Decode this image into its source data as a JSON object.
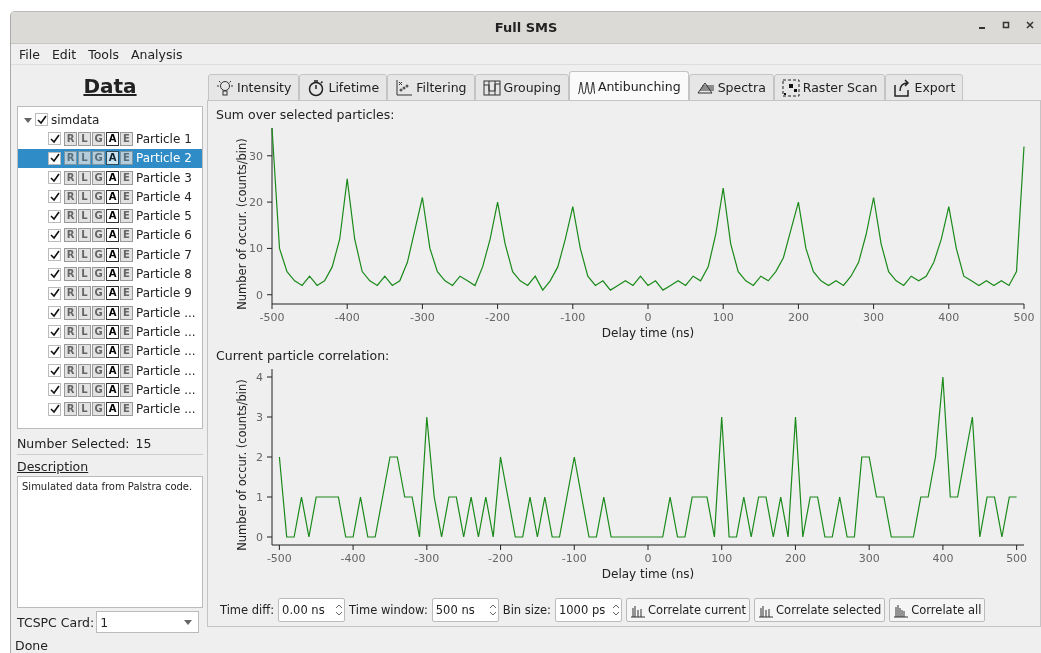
{
  "window": {
    "title": "Full SMS"
  },
  "menu": [
    "File",
    "Edit",
    "Tools",
    "Analysis"
  ],
  "data_panel": {
    "title": "Data",
    "tree": {
      "label": "simdata",
      "checked": true,
      "expanded": true,
      "children": [
        {
          "label": "Particle 1",
          "checked": true,
          "selected": false,
          "flags": [
            {
              "label": "R",
              "on": false
            },
            {
              "label": "L",
              "on": false
            },
            {
              "label": "G",
              "on": false
            },
            {
              "label": "A",
              "on": true
            },
            {
              "label": "E",
              "on": false
            }
          ]
        },
        {
          "label": "Particle 2",
          "checked": true,
          "selected": true,
          "flags": [
            {
              "label": "R",
              "on": false
            },
            {
              "label": "L",
              "on": false
            },
            {
              "label": "G",
              "on": false
            },
            {
              "label": "A",
              "on": true
            },
            {
              "label": "E",
              "on": false
            }
          ]
        },
        {
          "label": "Particle 3",
          "checked": true,
          "selected": false,
          "flags": [
            {
              "label": "R",
              "on": false
            },
            {
              "label": "L",
              "on": false
            },
            {
              "label": "G",
              "on": false
            },
            {
              "label": "A",
              "on": true
            },
            {
              "label": "E",
              "on": false
            }
          ]
        },
        {
          "label": "Particle 4",
          "checked": true,
          "selected": false,
          "flags": [
            {
              "label": "R",
              "on": false
            },
            {
              "label": "L",
              "on": false
            },
            {
              "label": "G",
              "on": false
            },
            {
              "label": "A",
              "on": true
            },
            {
              "label": "E",
              "on": false
            }
          ]
        },
        {
          "label": "Particle 5",
          "checked": true,
          "selected": false,
          "flags": [
            {
              "label": "R",
              "on": false
            },
            {
              "label": "L",
              "on": false
            },
            {
              "label": "G",
              "on": false
            },
            {
              "label": "A",
              "on": true
            },
            {
              "label": "E",
              "on": false
            }
          ]
        },
        {
          "label": "Particle 6",
          "checked": true,
          "selected": false,
          "flags": [
            {
              "label": "R",
              "on": false
            },
            {
              "label": "L",
              "on": false
            },
            {
              "label": "G",
              "on": false
            },
            {
              "label": "A",
              "on": true
            },
            {
              "label": "E",
              "on": false
            }
          ]
        },
        {
          "label": "Particle 7",
          "checked": true,
          "selected": false,
          "flags": [
            {
              "label": "R",
              "on": false
            },
            {
              "label": "L",
              "on": false
            },
            {
              "label": "G",
              "on": false
            },
            {
              "label": "A",
              "on": true
            },
            {
              "label": "E",
              "on": false
            }
          ]
        },
        {
          "label": "Particle 8",
          "checked": true,
          "selected": false,
          "flags": [
            {
              "label": "R",
              "on": false
            },
            {
              "label": "L",
              "on": false
            },
            {
              "label": "G",
              "on": false
            },
            {
              "label": "A",
              "on": true
            },
            {
              "label": "E",
              "on": false
            }
          ]
        },
        {
          "label": "Particle 9",
          "checked": true,
          "selected": false,
          "flags": [
            {
              "label": "R",
              "on": false
            },
            {
              "label": "L",
              "on": false
            },
            {
              "label": "G",
              "on": false
            },
            {
              "label": "A",
              "on": true
            },
            {
              "label": "E",
              "on": false
            }
          ]
        },
        {
          "label": "Particle ...",
          "checked": true,
          "selected": false,
          "flags": [
            {
              "label": "R",
              "on": false
            },
            {
              "label": "L",
              "on": false
            },
            {
              "label": "G",
              "on": false
            },
            {
              "label": "A",
              "on": true
            },
            {
              "label": "E",
              "on": false
            }
          ]
        },
        {
          "label": "Particle ...",
          "checked": true,
          "selected": false,
          "flags": [
            {
              "label": "R",
              "on": false
            },
            {
              "label": "L",
              "on": false
            },
            {
              "label": "G",
              "on": false
            },
            {
              "label": "A",
              "on": true
            },
            {
              "label": "E",
              "on": false
            }
          ]
        },
        {
          "label": "Particle ...",
          "checked": true,
          "selected": false,
          "flags": [
            {
              "label": "R",
              "on": false
            },
            {
              "label": "L",
              "on": false
            },
            {
              "label": "G",
              "on": false
            },
            {
              "label": "A",
              "on": true
            },
            {
              "label": "E",
              "on": false
            }
          ]
        },
        {
          "label": "Particle ...",
          "checked": true,
          "selected": false,
          "flags": [
            {
              "label": "R",
              "on": false
            },
            {
              "label": "L",
              "on": false
            },
            {
              "label": "G",
              "on": false
            },
            {
              "label": "A",
              "on": true
            },
            {
              "label": "E",
              "on": false
            }
          ]
        },
        {
          "label": "Particle ...",
          "checked": true,
          "selected": false,
          "flags": [
            {
              "label": "R",
              "on": false
            },
            {
              "label": "L",
              "on": false
            },
            {
              "label": "G",
              "on": false
            },
            {
              "label": "A",
              "on": true
            },
            {
              "label": "E",
              "on": false
            }
          ]
        },
        {
          "label": "Particle ...",
          "checked": true,
          "selected": false,
          "flags": [
            {
              "label": "R",
              "on": false
            },
            {
              "label": "L",
              "on": false
            },
            {
              "label": "G",
              "on": false
            },
            {
              "label": "A",
              "on": true
            },
            {
              "label": "E",
              "on": false
            }
          ]
        }
      ]
    },
    "number_selected": {
      "label": "Number Selected:",
      "value": "15"
    },
    "description": {
      "label": "Description",
      "text": "Simulated data from Palstra code."
    },
    "tcspc_card": {
      "label": "TCSPC Card:",
      "value": "1"
    }
  },
  "tabs": [
    {
      "label": "Intensity",
      "kind": "bulb",
      "selected": false
    },
    {
      "label": "Lifetime",
      "kind": "stopwatch",
      "selected": false
    },
    {
      "label": "Filtering",
      "kind": "filter",
      "selected": false
    },
    {
      "label": "Grouping",
      "kind": "group",
      "selected": false
    },
    {
      "label": "Antibunching",
      "kind": "peaks",
      "selected": true
    },
    {
      "label": "Spectra",
      "kind": "spectra",
      "selected": false
    },
    {
      "label": "Raster Scan",
      "kind": "raster",
      "selected": false
    },
    {
      "label": "Export",
      "kind": "export",
      "selected": false
    }
  ],
  "plots": [
    {
      "title": "Sum over selected particles:",
      "chart_data": {
        "type": "line",
        "xlabel": "Delay time (ns)",
        "ylabel": "Number of occur. (counts/bin)",
        "xlim": [
          -500,
          500
        ],
        "ylim": [
          -2,
          36
        ],
        "xticks": [
          -500,
          -400,
          -300,
          -200,
          -100,
          0,
          100,
          200,
          300,
          400,
          500
        ],
        "yticks": [
          0,
          10,
          20,
          30
        ],
        "x": [
          -500,
          -490,
          -480,
          -470,
          -460,
          -450,
          -440,
          -430,
          -420,
          -410,
          -400,
          -390,
          -380,
          -370,
          -360,
          -350,
          -340,
          -330,
          -320,
          -310,
          -300,
          -290,
          -280,
          -270,
          -260,
          -250,
          -240,
          -230,
          -220,
          -210,
          -200,
          -190,
          -180,
          -170,
          -160,
          -150,
          -140,
          -130,
          -120,
          -110,
          -100,
          -90,
          -80,
          -70,
          -60,
          -50,
          -40,
          -30,
          -20,
          -10,
          0,
          10,
          20,
          30,
          40,
          50,
          60,
          70,
          80,
          90,
          100,
          110,
          120,
          130,
          140,
          150,
          160,
          170,
          180,
          190,
          200,
          210,
          220,
          230,
          240,
          250,
          260,
          270,
          280,
          290,
          300,
          310,
          320,
          330,
          340,
          350,
          360,
          370,
          380,
          390,
          400,
          410,
          420,
          430,
          440,
          450,
          460,
          470,
          480,
          490,
          500
        ],
        "series": [
          {
            "color": "#1a8a1a",
            "values": [
              36,
              10,
              5,
              3,
              2,
              4,
              2,
              3,
              6,
              12,
              25,
              12,
              5,
              3,
              2,
              4,
              2,
              3,
              7,
              14,
              21,
              10,
              5,
              3,
              2,
              4,
              3,
              2,
              6,
              12,
              20,
              11,
              5,
              3,
              2,
              4,
              1,
              3,
              6,
              12,
              19,
              10,
              4,
              2,
              3,
              1,
              2,
              3,
              2,
              4,
              2,
              3,
              1,
              2,
              3,
              2,
              4,
              3,
              6,
              13,
              23,
              11,
              5,
              3,
              2,
              4,
              3,
              5,
              8,
              14,
              20,
              10,
              5,
              3,
              2,
              3,
              2,
              4,
              7,
              13,
              21,
              11,
              5,
              3,
              2,
              4,
              3,
              4,
              7,
              12,
              19,
              10,
              4,
              3,
              2,
              3,
              2,
              3,
              2,
              5,
              32
            ]
          }
        ]
      }
    },
    {
      "title": "Current particle correlation:",
      "chart_data": {
        "type": "line",
        "xlabel": "Delay time (ns)",
        "ylabel": "Number of occur. (counts/bin)",
        "xlim": [
          -510,
          510
        ],
        "ylim": [
          -0.2,
          4.2
        ],
        "xticks": [
          -500,
          -400,
          -300,
          -200,
          -100,
          0,
          100,
          200,
          300,
          400,
          500
        ],
        "yticks": [
          0,
          1,
          2,
          3,
          4
        ],
        "x": [
          -500,
          -490,
          -480,
          -470,
          -460,
          -450,
          -440,
          -430,
          -420,
          -410,
          -400,
          -390,
          -380,
          -370,
          -360,
          -350,
          -340,
          -330,
          -320,
          -310,
          -300,
          -290,
          -280,
          -270,
          -260,
          -250,
          -240,
          -230,
          -220,
          -210,
          -200,
          -190,
          -180,
          -170,
          -160,
          -150,
          -140,
          -130,
          -120,
          -110,
          -100,
          -90,
          -80,
          -70,
          -60,
          -50,
          -40,
          -30,
          -20,
          -10,
          0,
          10,
          20,
          30,
          40,
          50,
          60,
          70,
          80,
          90,
          100,
          110,
          120,
          130,
          140,
          150,
          160,
          170,
          180,
          190,
          200,
          210,
          220,
          230,
          240,
          250,
          260,
          270,
          280,
          290,
          300,
          310,
          320,
          330,
          340,
          350,
          360,
          370,
          380,
          390,
          400,
          410,
          420,
          430,
          440,
          450,
          460,
          470,
          480,
          490,
          500
        ],
        "series": [
          {
            "color": "#1a8a1a",
            "values": [
              2,
              0,
              0,
              1,
              0,
              1,
              1,
              1,
              1,
              0,
              0,
              1,
              0,
              0,
              1,
              2,
              2,
              1,
              1,
              0,
              3,
              1,
              0,
              1,
              1,
              0,
              1,
              0,
              1,
              0,
              2,
              1,
              0,
              0,
              1,
              0,
              1,
              0,
              0,
              1,
              2,
              1,
              0,
              0,
              1,
              0,
              0,
              0,
              0,
              0,
              0,
              0,
              0,
              1,
              0,
              0,
              1,
              1,
              1,
              0,
              3,
              0,
              0,
              1,
              0,
              1,
              1,
              0,
              1,
              0,
              3,
              0,
              1,
              1,
              0,
              0,
              1,
              0,
              0,
              2,
              2,
              1,
              1,
              0,
              0,
              0,
              0,
              1,
              1,
              2,
              4,
              1,
              1,
              2,
              3,
              0,
              1,
              1,
              0,
              1,
              1
            ]
          }
        ]
      }
    }
  ],
  "controls": {
    "fields": [
      {
        "label": "Time diff:",
        "value": "0.00 ns"
      },
      {
        "label": "Time window:",
        "value": "500 ns"
      },
      {
        "label": "Bin size:",
        "value": "1000 ps"
      }
    ],
    "buttons": [
      "Correlate current",
      "Correlate selected",
      "Correlate all"
    ]
  },
  "status_bar": "Done"
}
